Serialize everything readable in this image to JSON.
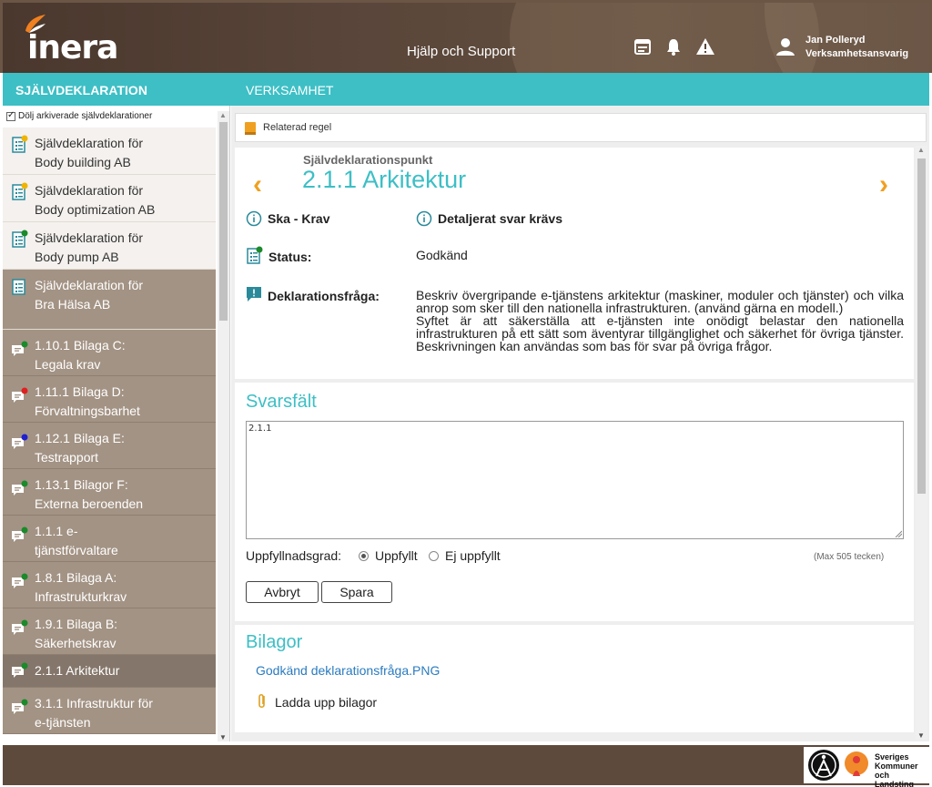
{
  "header": {
    "logo_text": "inera",
    "help_link": "Hjälp och Support",
    "user": {
      "name": "Jan Polleryd",
      "role": "Verksamhetsansvarig"
    },
    "icons": [
      "calendar-icon",
      "bell-icon",
      "warning-icon",
      "user-icon"
    ]
  },
  "nav_bar": {
    "left_title": "SJÄLVDEKLARATION",
    "right_title": "VERKSAMHET"
  },
  "sidebar": {
    "hide_archived_label": "Dölj arkiverade självdeklarationer",
    "hide_archived_checked": true,
    "declarations": [
      {
        "line1": "Självdeklaration för",
        "line2": "Body building AB",
        "badge": "#f0b400"
      },
      {
        "line1": "Självdeklaration för",
        "line2": "Body optimization AB",
        "badge": "#f0b400"
      },
      {
        "line1": "Självdeklaration för",
        "line2": "Body pump AB",
        "badge": "#1a8a2a"
      },
      {
        "line1": "Självdeklaration för",
        "line2": "Bra Hälsa AB",
        "badge": ""
      }
    ],
    "points": [
      {
        "line1": "1.10.1 Bilaga C:",
        "line2": "Legala krav",
        "badge": "#1a8a2a"
      },
      {
        "line1": "1.11.1 Bilaga D:",
        "line2": "Förvaltningsbarhet",
        "badge": "#e02020"
      },
      {
        "line1": "1.12.1 Bilaga E:",
        "line2": "Testrapport",
        "badge": "#2020d0"
      },
      {
        "line1": "1.13.1 Bilagor F:",
        "line2": "Externa beroenden",
        "badge": "#1a8a2a"
      },
      {
        "line1": "1.1.1 e-",
        "line2": "tjänstförvaltare",
        "badge": "#1a8a2a"
      },
      {
        "line1": "1.8.1 Bilaga A:",
        "line2": "Infrastrukturkrav",
        "badge": "#1a8a2a"
      },
      {
        "line1": "1.9.1 Bilaga B:",
        "line2": "Säkerhetskrav",
        "badge": "#1a8a2a"
      },
      {
        "line1": "2.1.1 Arkitektur",
        "line2": "",
        "badge": "#1a8a2a"
      },
      {
        "line1": "3.1.1 Infrastruktur för",
        "line2": "e-tjänsten",
        "badge": "#1a8a2a"
      }
    ]
  },
  "main": {
    "related_rule": "Relaterad regel",
    "point_label": "Självdeklarationspunkt",
    "point_title": "2.1.1 Arkitektur",
    "requirement": "Ska - Krav",
    "detail": "Detaljerat svar krävs",
    "status_label": "Status:",
    "status_value": "Godkänd",
    "question_label": "Deklarationsfråga:",
    "question_p1": "Beskriv övergripande e-tjänstens arkitektur (maskiner, moduler och tjänster) och vilka anrop som sker till den nationella infrastrukturen. (använd gärna en modell.)",
    "question_p2": "Syftet är att säkerställa att e-tjänsten inte onödigt belastar den nationella infrastrukturen på ett sätt som äventyrar tillgänglighet och säkerhet för övriga tjänster. Beskrivningen kan användas som bas för svar på övriga frågor.",
    "answer_title": "Svarsfält",
    "answer_value": "2.1.1",
    "fulfillment_label": "Uppfyllnadsgrad:",
    "option_yes": "Uppfyllt",
    "option_no": "Ej uppfyllt",
    "selected_option": "Uppfyllt",
    "max_chars": "(Max 505 tecken)",
    "cancel_button": "Avbryt",
    "save_button": "Spara",
    "attachments_title": "Bilagor",
    "attachment_file": "Godkänd deklarationsfråga.PNG",
    "upload_label": "Ladda upp bilagor"
  },
  "footer": {
    "skl_line1": "Sveriges",
    "skl_line2": "Kommuner",
    "skl_line3": "och Landsting"
  },
  "colors": {
    "accent": "#3dbfc5",
    "header": "#5a463a",
    "sidebar_active": "#a39384",
    "arrow": "#f0a020",
    "link": "#2a7bbf"
  }
}
